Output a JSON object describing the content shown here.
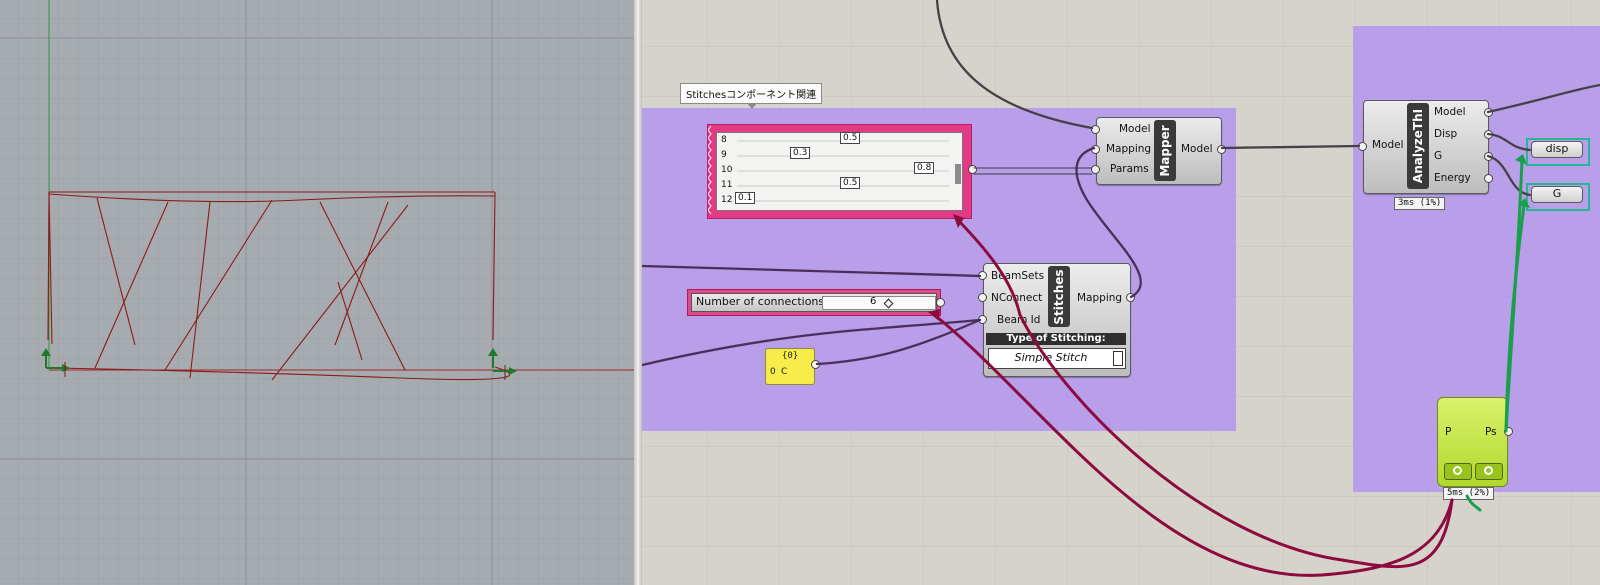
{
  "group": {
    "label": "Stitchesコンポーネント関連"
  },
  "graph_mapper": {
    "rows": [
      {
        "label": "8",
        "value": "0.5"
      },
      {
        "label": "9",
        "value": "0.3"
      },
      {
        "label": "10",
        "value": "0.8"
      },
      {
        "label": "11",
        "value": "0.5"
      },
      {
        "label": "12",
        "value": "0.1"
      }
    ]
  },
  "mapper": {
    "inputs": [
      "Model",
      "Mapping",
      "Params"
    ],
    "nickname": "Mapper",
    "outputs": [
      "Model"
    ]
  },
  "stitches": {
    "inputs": [
      "BeamSets",
      "NConnect",
      "Beam Id"
    ],
    "nickname": "Stitches",
    "outputs": [
      "Mapping"
    ],
    "dropdown_title": "Type of Stitching:",
    "dropdown_value": "Simple Stitch"
  },
  "slider": {
    "label": "Number of connections",
    "value": "6"
  },
  "panel": {
    "header": "{0}",
    "index": "0",
    "value": "C"
  },
  "analyze": {
    "inputs": [
      "Model"
    ],
    "nickname": "AnalyzeThI",
    "outputs": [
      "Model",
      "Disp",
      "G",
      "Energy"
    ],
    "timer": "3ms (1%)"
  },
  "relays": [
    "disp",
    "G"
  ],
  "green_component": {
    "input": "P",
    "output": "Ps",
    "timer": "5ms (2%)"
  },
  "colors": {
    "viewport_bg": "#a6abb0",
    "canvas_bg": "#d6d3cc",
    "group_fill": "#b292f0",
    "selection_pink": "#e33a86",
    "wire_selected": "#8d0a3f",
    "wire_active": "#1aa04a",
    "geometry_red": "#8b1a1a"
  }
}
